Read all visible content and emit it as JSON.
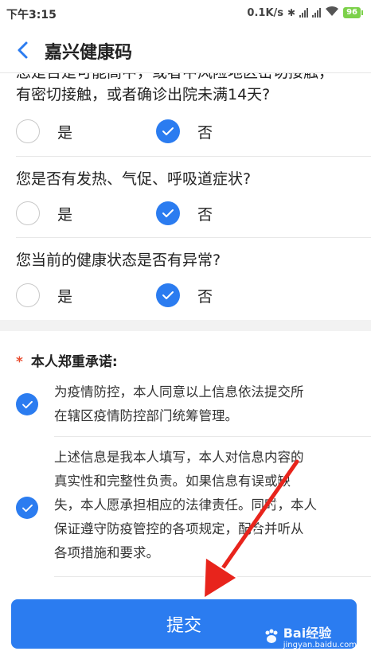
{
  "status_bar": {
    "time": "下午3:15",
    "network_speed": "0.1K/s",
    "battery": "96"
  },
  "header": {
    "back_icon": "chevron-left-icon",
    "title": "嘉兴健康码"
  },
  "questions": [
    {
      "text_line1": "您是否是可能高中，或者中风险地区密切接触，",
      "text_line2": "有密切接触，或者确诊出院未满14天?",
      "yes_label": "是",
      "no_label": "否",
      "selected": "否"
    },
    {
      "text": "您是否有发热、气促、呼吸道症状?",
      "yes_label": "是",
      "no_label": "否",
      "selected": "否"
    },
    {
      "text": "您当前的健康状态是否有异常?",
      "yes_label": "是",
      "no_label": "否",
      "selected": "否"
    }
  ],
  "commitment": {
    "required_mark": "*",
    "title": "本人郑重承诺:",
    "items": [
      {
        "line1": "为疫情防控，本人同意以上信息依法提交所",
        "line2": "在辖区疫情防控部门统筹管理。",
        "checked": true
      },
      {
        "line1": "上述信息是我本人填写，本人对信息内容的",
        "line2": "真实性和完整性负责。如果信息有误或缺",
        "line3": "失，本人愿承担相应的法律责任。同时，本人",
        "line4": "保证遵守防疫管控的各项规定，配合并听从",
        "line5": "各项措施和要求。",
        "checked": true
      }
    ]
  },
  "submit_label": "提交",
  "annotation": {
    "arrow_color": "#e8241c"
  },
  "watermark": {
    "brand": "Bai",
    "brand2": "经验",
    "url": "jingyan.baidu.com"
  },
  "colors": {
    "accent": "#2b7cf0",
    "required": "#e84b2e"
  }
}
